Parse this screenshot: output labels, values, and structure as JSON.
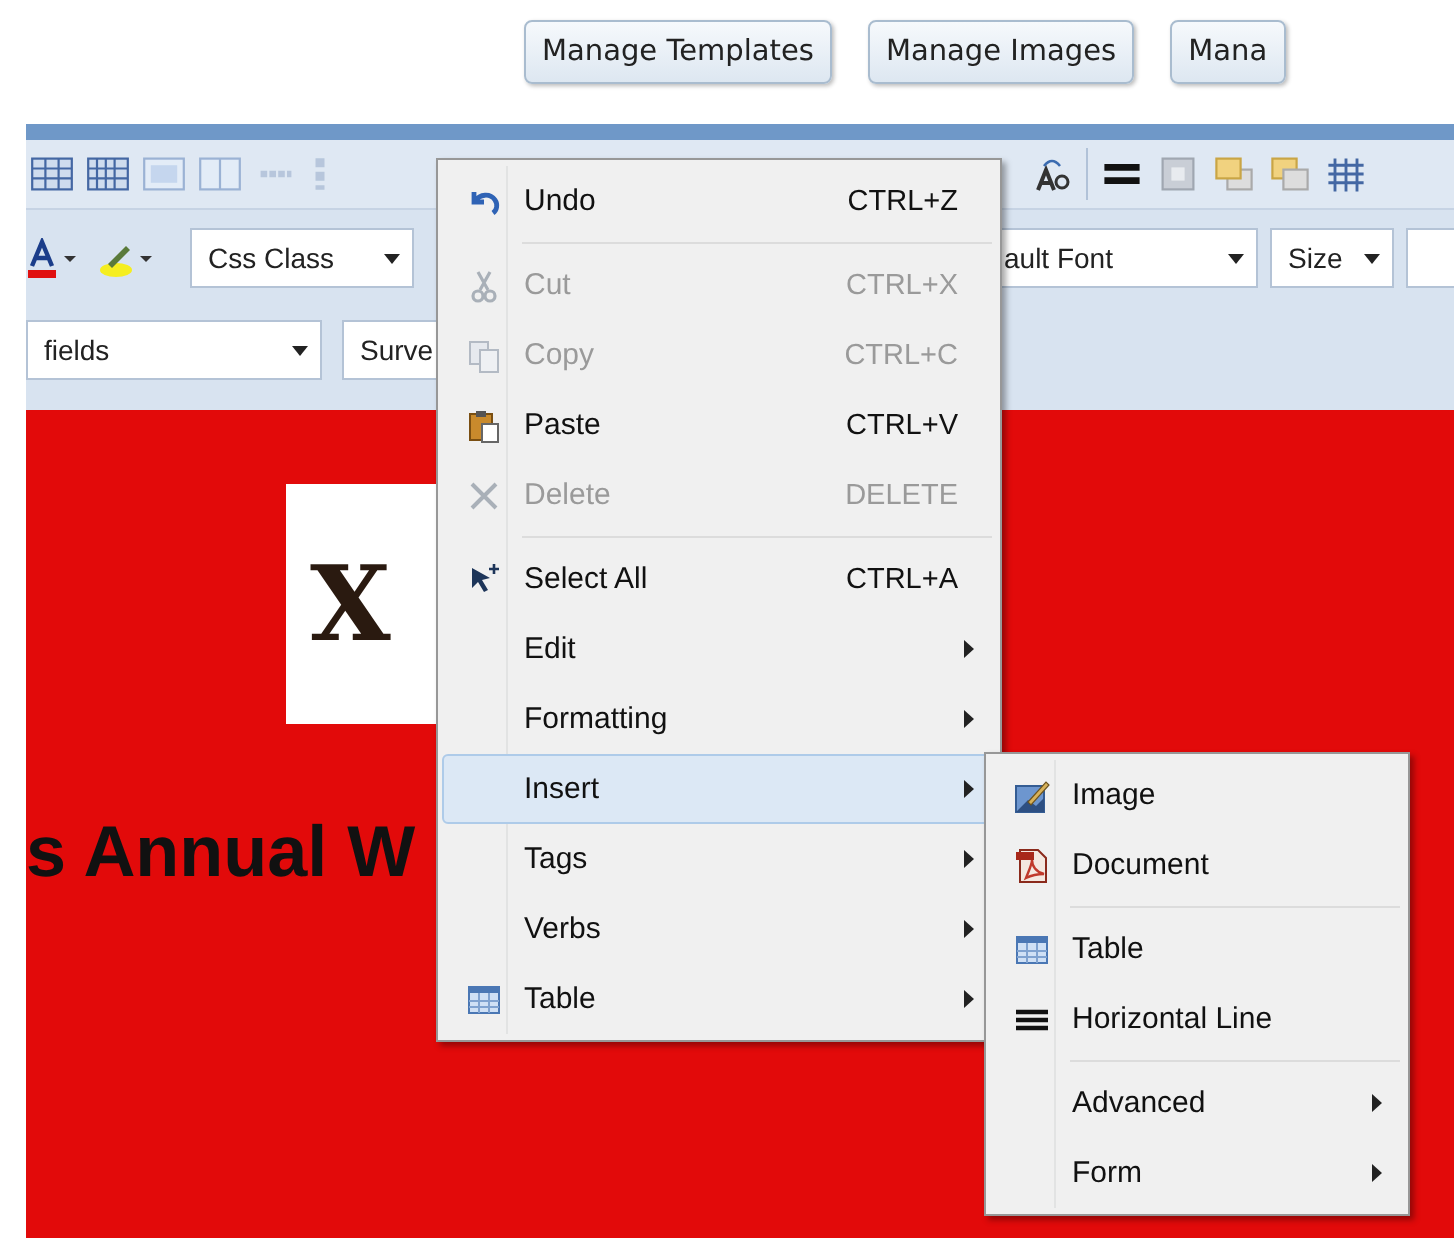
{
  "header_buttons": [
    {
      "label": "Manage Templates"
    },
    {
      "label": "Manage Images"
    },
    {
      "label": "Mana"
    }
  ],
  "toolbar": {
    "row2": [
      {
        "value": "Css Class"
      },
      {
        "value": "ault Font"
      },
      {
        "value": "Size"
      }
    ],
    "row3": [
      {
        "value": "fields"
      },
      {
        "value": "Surve"
      }
    ]
  },
  "content": {
    "logo_text": "X",
    "heading": "s Annual W"
  },
  "context_menu": {
    "groups": [
      [
        {
          "label": "Undo",
          "shortcut": "CTRL+Z",
          "disabled": false,
          "submenu": false,
          "selected": false
        }
      ],
      [
        {
          "label": "Cut",
          "shortcut": "CTRL+X",
          "disabled": true,
          "submenu": false,
          "selected": false
        },
        {
          "label": "Copy",
          "shortcut": "CTRL+C",
          "disabled": true,
          "submenu": false,
          "selected": false
        },
        {
          "label": "Paste",
          "shortcut": "CTRL+V",
          "disabled": false,
          "submenu": false,
          "selected": false
        },
        {
          "label": "Delete",
          "shortcut": "DELETE",
          "disabled": true,
          "submenu": false,
          "selected": false
        }
      ],
      [
        {
          "label": "Select All",
          "shortcut": "CTRL+A",
          "disabled": false,
          "submenu": false,
          "selected": false
        },
        {
          "label": "Edit",
          "disabled": false,
          "submenu": true,
          "selected": false
        },
        {
          "label": "Formatting",
          "disabled": false,
          "submenu": true,
          "selected": false
        },
        {
          "label": "Insert",
          "disabled": false,
          "submenu": true,
          "selected": true
        },
        {
          "label": "Tags",
          "disabled": false,
          "submenu": true,
          "selected": false
        },
        {
          "label": "Verbs",
          "disabled": false,
          "submenu": true,
          "selected": false
        },
        {
          "label": "Table",
          "disabled": false,
          "submenu": true,
          "selected": false
        }
      ]
    ]
  },
  "submenu": {
    "groups": [
      [
        {
          "label": "Image",
          "submenu": false
        },
        {
          "label": "Document",
          "submenu": false
        }
      ],
      [
        {
          "label": "Table",
          "submenu": false
        },
        {
          "label": "Horizontal Line",
          "submenu": false
        }
      ],
      [
        {
          "label": "Advanced",
          "submenu": true
        },
        {
          "label": "Form",
          "submenu": true
        }
      ]
    ]
  }
}
